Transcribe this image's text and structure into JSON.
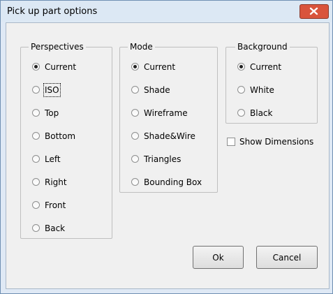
{
  "window": {
    "title": "Pick up part options",
    "close_icon": "close-icon"
  },
  "perspectives": {
    "legend": "Perspectives",
    "options": [
      "Current",
      "ISO",
      "Top",
      "Bottom",
      "Left",
      "Right",
      "Front",
      "Back"
    ],
    "selected": "Current"
  },
  "mode": {
    "legend": "Mode",
    "options": [
      "Current",
      "Shade",
      "Wireframe",
      "Shade&Wire",
      "Triangles",
      "Bounding Box"
    ],
    "selected": "Current"
  },
  "background": {
    "legend": "Background",
    "options": [
      "Current",
      "White",
      "Black"
    ],
    "selected": "Current"
  },
  "show_dimensions": {
    "label": "Show Dimensions",
    "checked": false
  },
  "buttons": {
    "ok": "Ok",
    "cancel": "Cancel"
  },
  "colors": {
    "close_button": "#d9543c",
    "window_frame": "#dfe9f5"
  }
}
